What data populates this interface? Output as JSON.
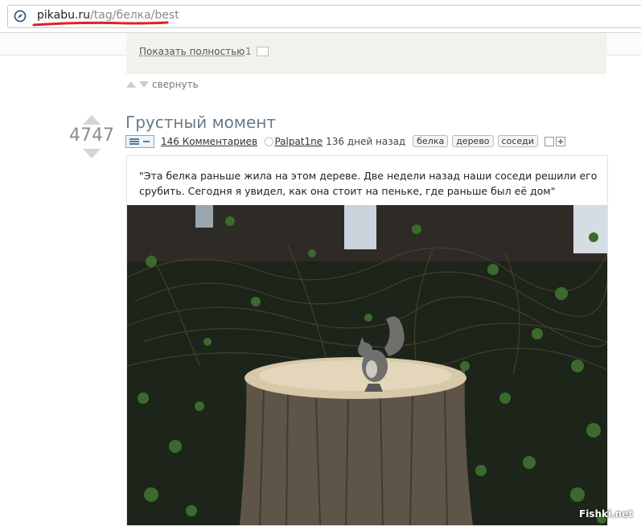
{
  "browser": {
    "url_host": "pikabu.ru",
    "url_path": "/tag/белка/best",
    "icon": "compass-icon"
  },
  "previous_post": {
    "show_full_label": "Показать полностью",
    "count": "1",
    "collapse_label": "свернуть"
  },
  "post": {
    "rating": "4747",
    "title": "Грустный момент",
    "comments": "146 Комментариев",
    "author": "Palpat1ne",
    "time": "136 дней назад",
    "tags": [
      "белка",
      "дерево",
      "соседи"
    ],
    "text": "\"Эта белка раньше жила на этом дереве. Две недели назад наши соседи решили его срубить. Сегодня я увидел, как она стоит на пеньке, где раньше был её дом\""
  },
  "watermark": "Fishki.net",
  "colors": {
    "title": "#6b7a85",
    "accent_underline": "#e0202a"
  }
}
